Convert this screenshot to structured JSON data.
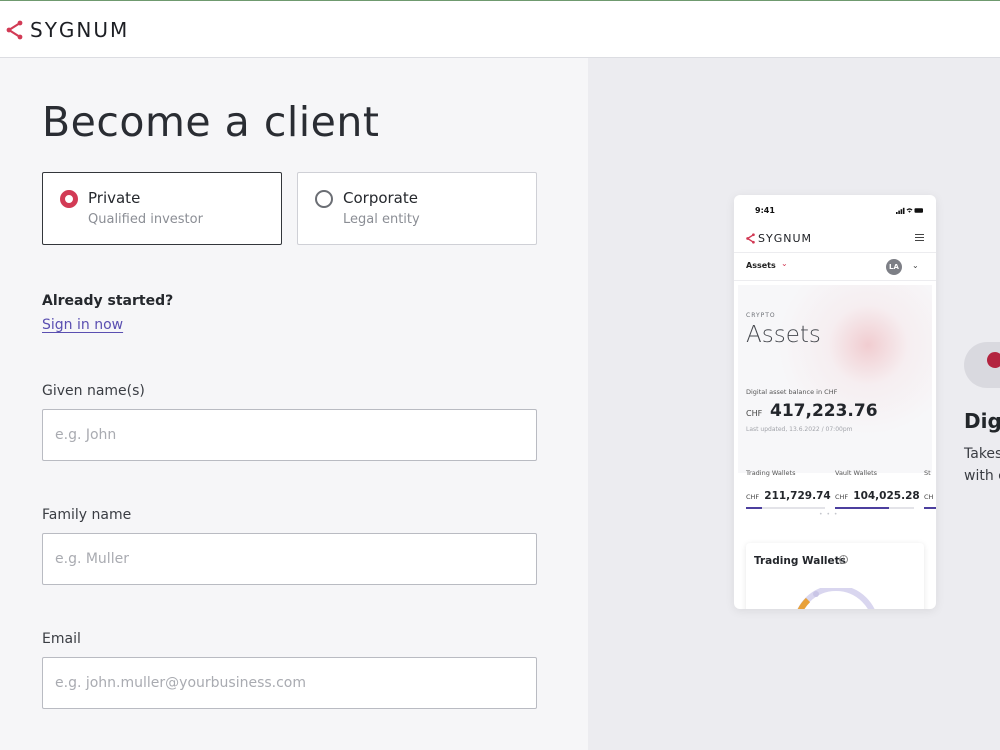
{
  "header": {
    "brand": "SYGNUM"
  },
  "form": {
    "title": "Become a client",
    "client_types": [
      {
        "label": "Private",
        "sub": "Qualified investor",
        "selected": true
      },
      {
        "label": "Corporate",
        "sub": "Legal entity",
        "selected": false
      }
    ],
    "already_started": "Already started?",
    "sign_in": "Sign in now",
    "fields": [
      {
        "label": "Given name(s)",
        "placeholder": "e.g. John",
        "value": ""
      },
      {
        "label": "Family name",
        "placeholder": "e.g. Muller",
        "value": ""
      },
      {
        "label": "Email",
        "placeholder": "e.g. john.muller@yourbusiness.com",
        "value": ""
      }
    ]
  },
  "phone": {
    "time": "9:41",
    "brand": "SYGNUM",
    "nav_tab": "Assets",
    "avatar": "LA",
    "category": "CRYPTO",
    "section_title": "Assets",
    "balance_label": "Digital asset balance in CHF",
    "currency": "CHF",
    "balance": "417,223.76",
    "last_updated": "Last updated, 13.6.2022 / 07:00pm",
    "wallets": [
      {
        "label": "Trading Wallets",
        "currency": "CHF",
        "value": "211,729.74",
        "fill_percent": 20
      },
      {
        "label": "Vault Wallets",
        "currency": "CHF",
        "value": "104,025.28",
        "fill_percent": 68
      },
      {
        "label": "St",
        "currency": "CH",
        "value": "",
        "fill_percent": 40
      }
    ],
    "card_title": "Trading Wallets",
    "info_icon": "i"
  },
  "promo": {
    "heading": "Dig",
    "line1": "Takes",
    "line2": "with c"
  },
  "colors": {
    "accent": "#d23a55",
    "link": "#5a4fb1",
    "wallet_bar": "#4c3f9e"
  }
}
